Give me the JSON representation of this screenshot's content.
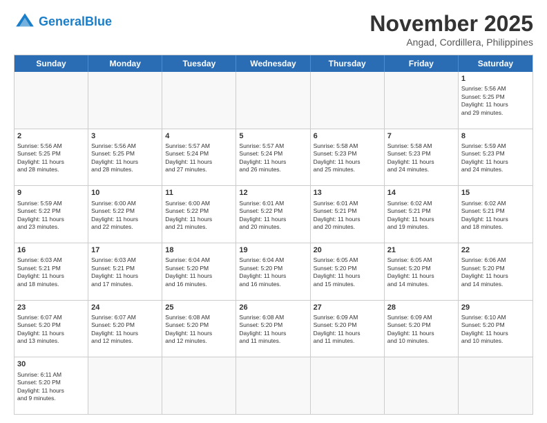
{
  "header": {
    "logo_general": "General",
    "logo_blue": "Blue",
    "month_title": "November 2025",
    "location": "Angad, Cordillera, Philippines"
  },
  "weekdays": [
    "Sunday",
    "Monday",
    "Tuesday",
    "Wednesday",
    "Thursday",
    "Friday",
    "Saturday"
  ],
  "rows": [
    [
      {
        "day": "",
        "text": ""
      },
      {
        "day": "",
        "text": ""
      },
      {
        "day": "",
        "text": ""
      },
      {
        "day": "",
        "text": ""
      },
      {
        "day": "",
        "text": ""
      },
      {
        "day": "",
        "text": ""
      },
      {
        "day": "1",
        "text": "Sunrise: 5:56 AM\nSunset: 5:25 PM\nDaylight: 11 hours\nand 29 minutes."
      }
    ],
    [
      {
        "day": "2",
        "text": "Sunrise: 5:56 AM\nSunset: 5:25 PM\nDaylight: 11 hours\nand 28 minutes."
      },
      {
        "day": "3",
        "text": "Sunrise: 5:56 AM\nSunset: 5:25 PM\nDaylight: 11 hours\nand 28 minutes."
      },
      {
        "day": "4",
        "text": "Sunrise: 5:57 AM\nSunset: 5:24 PM\nDaylight: 11 hours\nand 27 minutes."
      },
      {
        "day": "5",
        "text": "Sunrise: 5:57 AM\nSunset: 5:24 PM\nDaylight: 11 hours\nand 26 minutes."
      },
      {
        "day": "6",
        "text": "Sunrise: 5:58 AM\nSunset: 5:23 PM\nDaylight: 11 hours\nand 25 minutes."
      },
      {
        "day": "7",
        "text": "Sunrise: 5:58 AM\nSunset: 5:23 PM\nDaylight: 11 hours\nand 24 minutes."
      },
      {
        "day": "8",
        "text": "Sunrise: 5:59 AM\nSunset: 5:23 PM\nDaylight: 11 hours\nand 24 minutes."
      }
    ],
    [
      {
        "day": "9",
        "text": "Sunrise: 5:59 AM\nSunset: 5:22 PM\nDaylight: 11 hours\nand 23 minutes."
      },
      {
        "day": "10",
        "text": "Sunrise: 6:00 AM\nSunset: 5:22 PM\nDaylight: 11 hours\nand 22 minutes."
      },
      {
        "day": "11",
        "text": "Sunrise: 6:00 AM\nSunset: 5:22 PM\nDaylight: 11 hours\nand 21 minutes."
      },
      {
        "day": "12",
        "text": "Sunrise: 6:01 AM\nSunset: 5:22 PM\nDaylight: 11 hours\nand 20 minutes."
      },
      {
        "day": "13",
        "text": "Sunrise: 6:01 AM\nSunset: 5:21 PM\nDaylight: 11 hours\nand 20 minutes."
      },
      {
        "day": "14",
        "text": "Sunrise: 6:02 AM\nSunset: 5:21 PM\nDaylight: 11 hours\nand 19 minutes."
      },
      {
        "day": "15",
        "text": "Sunrise: 6:02 AM\nSunset: 5:21 PM\nDaylight: 11 hours\nand 18 minutes."
      }
    ],
    [
      {
        "day": "16",
        "text": "Sunrise: 6:03 AM\nSunset: 5:21 PM\nDaylight: 11 hours\nand 18 minutes."
      },
      {
        "day": "17",
        "text": "Sunrise: 6:03 AM\nSunset: 5:21 PM\nDaylight: 11 hours\nand 17 minutes."
      },
      {
        "day": "18",
        "text": "Sunrise: 6:04 AM\nSunset: 5:20 PM\nDaylight: 11 hours\nand 16 minutes."
      },
      {
        "day": "19",
        "text": "Sunrise: 6:04 AM\nSunset: 5:20 PM\nDaylight: 11 hours\nand 16 minutes."
      },
      {
        "day": "20",
        "text": "Sunrise: 6:05 AM\nSunset: 5:20 PM\nDaylight: 11 hours\nand 15 minutes."
      },
      {
        "day": "21",
        "text": "Sunrise: 6:05 AM\nSunset: 5:20 PM\nDaylight: 11 hours\nand 14 minutes."
      },
      {
        "day": "22",
        "text": "Sunrise: 6:06 AM\nSunset: 5:20 PM\nDaylight: 11 hours\nand 14 minutes."
      }
    ],
    [
      {
        "day": "23",
        "text": "Sunrise: 6:07 AM\nSunset: 5:20 PM\nDaylight: 11 hours\nand 13 minutes."
      },
      {
        "day": "24",
        "text": "Sunrise: 6:07 AM\nSunset: 5:20 PM\nDaylight: 11 hours\nand 12 minutes."
      },
      {
        "day": "25",
        "text": "Sunrise: 6:08 AM\nSunset: 5:20 PM\nDaylight: 11 hours\nand 12 minutes."
      },
      {
        "day": "26",
        "text": "Sunrise: 6:08 AM\nSunset: 5:20 PM\nDaylight: 11 hours\nand 11 minutes."
      },
      {
        "day": "27",
        "text": "Sunrise: 6:09 AM\nSunset: 5:20 PM\nDaylight: 11 hours\nand 11 minutes."
      },
      {
        "day": "28",
        "text": "Sunrise: 6:09 AM\nSunset: 5:20 PM\nDaylight: 11 hours\nand 10 minutes."
      },
      {
        "day": "29",
        "text": "Sunrise: 6:10 AM\nSunset: 5:20 PM\nDaylight: 11 hours\nand 10 minutes."
      }
    ],
    [
      {
        "day": "30",
        "text": "Sunrise: 6:11 AM\nSunset: 5:20 PM\nDaylight: 11 hours\nand 9 minutes."
      },
      {
        "day": "",
        "text": ""
      },
      {
        "day": "",
        "text": ""
      },
      {
        "day": "",
        "text": ""
      },
      {
        "day": "",
        "text": ""
      },
      {
        "day": "",
        "text": ""
      },
      {
        "day": "",
        "text": ""
      }
    ]
  ]
}
